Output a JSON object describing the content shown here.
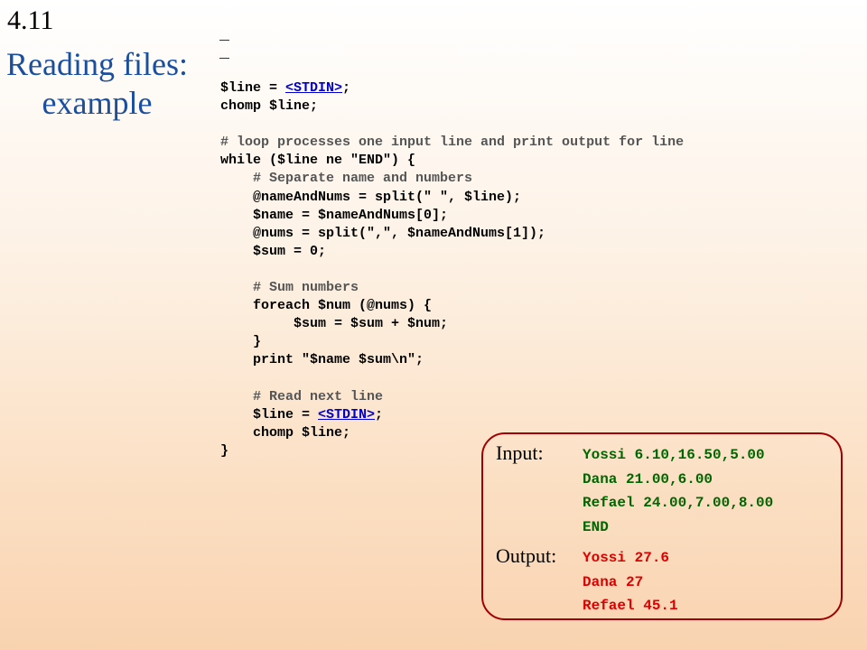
{
  "slide": {
    "number": "4.11",
    "title_line1": "Reading files:",
    "title_line2": "example"
  },
  "code": {
    "lines": [
      {
        "pre": "$line = ",
        "link": "<STDIN>",
        "post": ";",
        "comment": false
      },
      {
        "text": "chomp $line;",
        "comment": false
      },
      {
        "text": "",
        "comment": false
      },
      {
        "text": "# loop processes one input line and print output for line",
        "comment": true
      },
      {
        "text": "while ($line ne \"END\") {",
        "comment": false
      },
      {
        "text": "    # Separate name and numbers",
        "comment": true
      },
      {
        "text": "    @nameAndNums = split(\" \", $line);",
        "comment": false
      },
      {
        "text": "    $name = $nameAndNums[0];",
        "comment": false
      },
      {
        "text": "    @nums = split(\",\", $nameAndNums[1]);",
        "comment": false
      },
      {
        "text": "    $sum = 0;",
        "comment": false
      },
      {
        "text": "",
        "comment": false
      },
      {
        "text": "    # Sum numbers",
        "comment": true
      },
      {
        "text": "    foreach $num (@nums) {",
        "comment": false
      },
      {
        "text": "         $sum = $sum + $num;",
        "comment": false
      },
      {
        "text": "    }",
        "comment": false
      },
      {
        "text": "    print \"$name $sum\\n\";",
        "comment": false
      },
      {
        "text": "",
        "comment": false
      },
      {
        "text": "    # Read next line",
        "comment": true
      },
      {
        "pre": "    $line = ",
        "link": "<STDIN>",
        "post": ";",
        "comment": false
      },
      {
        "text": "    chomp $line;",
        "comment": false
      },
      {
        "text": "}",
        "comment": false
      }
    ]
  },
  "io": {
    "input_label": "Input:",
    "input_lines": [
      "Yossi 6.10,16.50,5.00",
      "Dana 21.00,6.00",
      "Refael 24.00,7.00,8.00",
      "END"
    ],
    "output_label": "Output:",
    "output_lines": [
      "Yossi 27.6",
      "Dana 27",
      "Refael 45.1"
    ],
    "colors": {
      "input": "#006600",
      "output": "#dd0000",
      "border": "#a00000"
    }
  }
}
